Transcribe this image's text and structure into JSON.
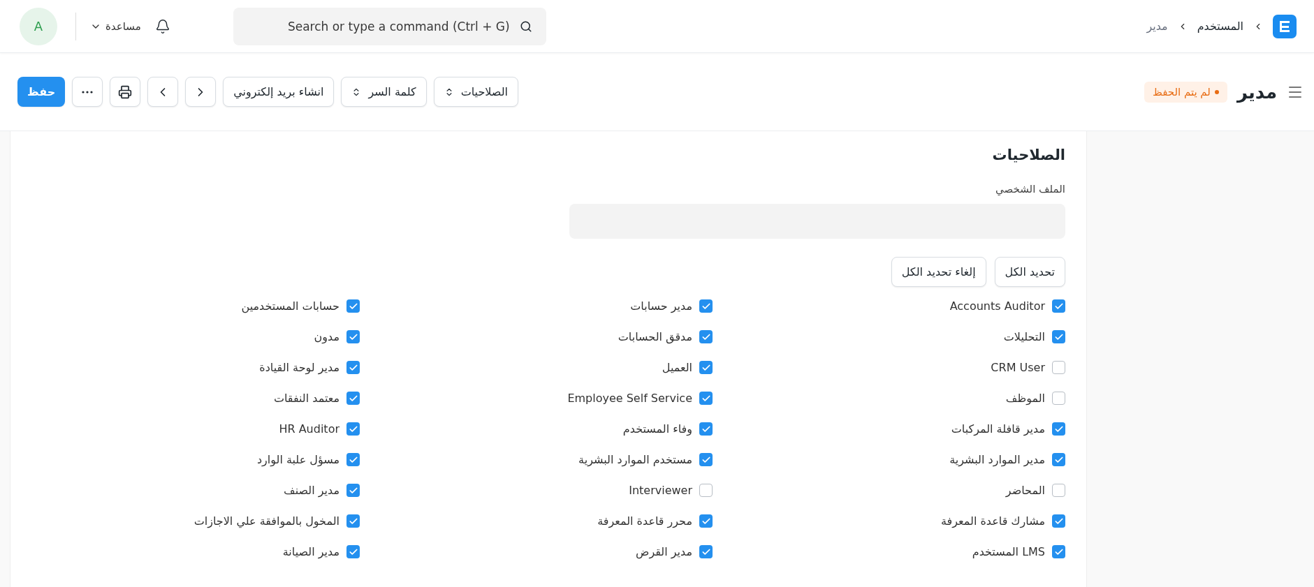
{
  "navbar": {
    "breadcrumbs": [
      "المستخدم",
      "مدير"
    ],
    "search": {
      "placeholder": "Search or type a command (Ctrl + G)"
    },
    "help": "مساعدة",
    "avatar": "A"
  },
  "page_header": {
    "title": "مدير",
    "status": "لم يتم الحفظ",
    "actions": [
      {
        "kind": "dropdown",
        "label": "الصلاحيات"
      },
      {
        "kind": "dropdown",
        "label": "كلمة السر"
      },
      {
        "kind": "text",
        "label": "انشاء بريد إلكتروني"
      },
      {
        "kind": "prev"
      },
      {
        "kind": "next"
      },
      {
        "kind": "print"
      },
      {
        "kind": "more"
      },
      {
        "kind": "primary",
        "label": "حفظ"
      }
    ]
  },
  "section": {
    "title": "الصلاحيات",
    "profile_field": {
      "label": "الملف الشخصي"
    },
    "buttons": [
      "تحديد الكل",
      "إلغاء تحديد الكل"
    ],
    "roles": [
      {
        "label": "Accounts Auditor",
        "checked": true
      },
      {
        "label": "مدير حسابات",
        "checked": true
      },
      {
        "label": "حسابات المستخدمين",
        "checked": true
      },
      {
        "label": "التحليلات",
        "checked": true
      },
      {
        "label": "مدقق الحسابات",
        "checked": true
      },
      {
        "label": "مدون",
        "checked": true
      },
      {
        "label": "CRM User",
        "checked": false
      },
      {
        "label": "العميل",
        "checked": true
      },
      {
        "label": "مدير لوحة القيادة",
        "checked": true
      },
      {
        "label": "الموظف",
        "checked": false
      },
      {
        "label": "Employee Self Service",
        "checked": true
      },
      {
        "label": "معتمد النفقات",
        "checked": true
      },
      {
        "label": "مدير قافلة المركبات",
        "checked": true
      },
      {
        "label": "وفاء المستخدم",
        "checked": true
      },
      {
        "label": "HR Auditor",
        "checked": true
      },
      {
        "label": "مدير الموارد البشرية",
        "checked": true
      },
      {
        "label": "مستخدم الموارد البشرية",
        "checked": true
      },
      {
        "label": "مسؤل علبة الوارد",
        "checked": true
      },
      {
        "label": "المحاضر",
        "checked": false
      },
      {
        "label": "Interviewer",
        "checked": false
      },
      {
        "label": "مدير الصنف",
        "checked": true
      },
      {
        "label": "مشارك قاعدة المعرفة",
        "checked": true
      },
      {
        "label": "محرر قاعدة المعرفة",
        "checked": true
      },
      {
        "label": "المخول بالموافقة علي الاجازات",
        "checked": true
      },
      {
        "label": "LMS المستخدم",
        "checked": true
      },
      {
        "label": "مدير القرض",
        "checked": true
      },
      {
        "label": "مدير الصيانة",
        "checked": true
      }
    ]
  }
}
